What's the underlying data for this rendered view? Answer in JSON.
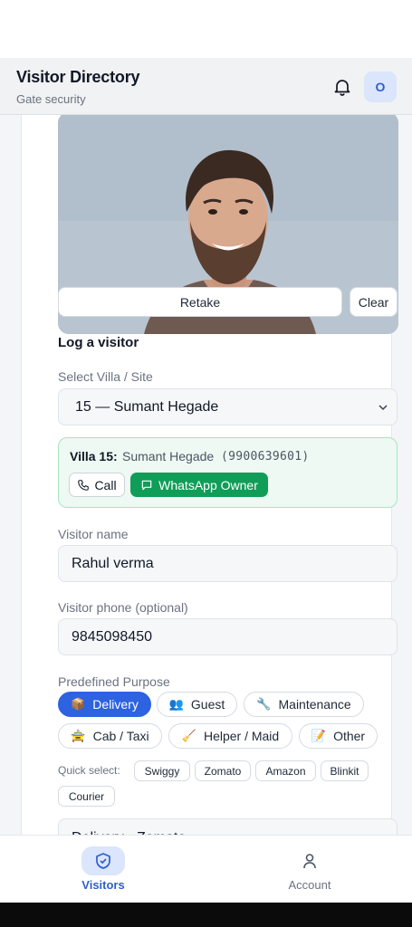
{
  "header": {
    "title": "Visitor Directory",
    "subtitle": "Gate security",
    "avatar_initial": "O",
    "bell_icon": "bell-icon"
  },
  "photo": {
    "retake_label": "Retake",
    "clear_label": "Clear"
  },
  "form": {
    "section_title": "Log a visitor",
    "villa_label": "Select Villa / Site",
    "villa_selected": "15 — Sumant Hegade",
    "owner": {
      "villa": "Villa 15:",
      "name": "Sumant Hegade",
      "phone": "(9900639601)",
      "call_label": "Call",
      "whatsapp_label": "WhatsApp Owner"
    },
    "visitor_name_label": "Visitor name",
    "visitor_name_value": "Rahul verma",
    "visitor_phone_label": "Visitor phone (optional)",
    "visitor_phone_value": "9845098450",
    "purpose_label": "Predefined Purpose",
    "purposes": [
      {
        "emoji": "📦",
        "label": "Delivery",
        "active": true
      },
      {
        "emoji": "👥",
        "label": "Guest",
        "active": false
      },
      {
        "emoji": "🔧",
        "label": "Maintenance",
        "active": false
      },
      {
        "emoji": "🚖",
        "label": "Cab / Taxi",
        "active": false
      },
      {
        "emoji": "🧹",
        "label": "Helper / Maid",
        "active": false
      },
      {
        "emoji": "📝",
        "label": "Other",
        "active": false
      }
    ],
    "quick_label": "Quick select:",
    "quick": [
      "Swiggy",
      "Zomato",
      "Amazon",
      "Blinkit",
      "Courier"
    ],
    "purpose_value": "Delivery - Zomato"
  },
  "nav": {
    "visitors_label": "Visitors",
    "account_label": "Account"
  },
  "colors": {
    "accent": "#2d62e0",
    "whatsapp": "#0f9d58",
    "owner_bg": "#eef9f3"
  }
}
